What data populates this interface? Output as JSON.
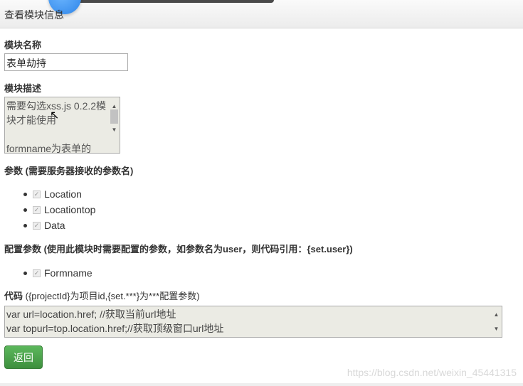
{
  "header": {
    "title": "查看模块信息"
  },
  "form": {
    "name_label": "模块名称",
    "name_value": "表单劫持",
    "desc_label": "模块描述",
    "desc_lines": [
      "需要勾选xss.js 0.2.2模",
      "块才能使用",
      "",
      "formname为表单的"
    ],
    "params_label": "参数",
    "params_note": "(需要服务器接收的参数名)",
    "params": [
      "Location",
      "Locationtop",
      "Data"
    ],
    "config_label": "配置参数",
    "config_note": "(使用此模块时需要配置的参数，如参数名为user，则代码引用：{set.user})",
    "config_params": [
      "Formname"
    ],
    "code_label": "代码",
    "code_note": "({projectId}为项目id,{set.***}为***配置参数)",
    "code_lines": [
      "var url=location.href; //获取当前url地址",
      "var topurl=top.location.href;//获取顶级窗口url地址"
    ],
    "back_label": "返回"
  },
  "watermark": "https://blog.csdn.net/weixin_45441315",
  "colors": {
    "button": "#4cae4c",
    "textarea_bg": "#ebebe4"
  }
}
